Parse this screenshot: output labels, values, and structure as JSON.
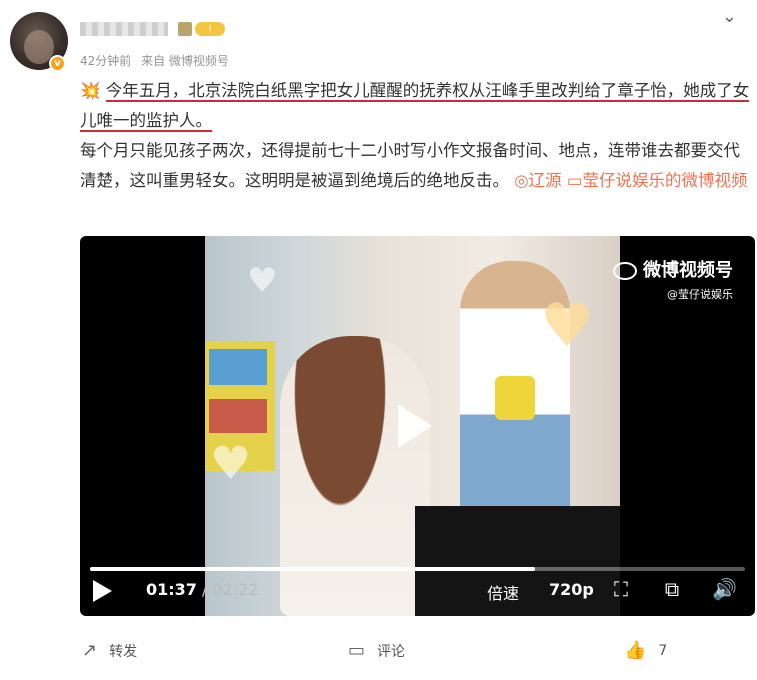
{
  "post": {
    "meta": {
      "time": "42分钟前",
      "source": "来自 微博视频号"
    },
    "rank_icon": "I",
    "text": {
      "emoji": "💥",
      "highlighted": "今年五月，北京法院白纸黑字把女儿醒醒的抚养权从汪峰手里改判给了章子怡，她成了女儿唯一的监护人。",
      "body": "每个月只能见孩子两次，还得提前七十二小时写小作文报备时间、地点，连带谁去都要交代清楚，这叫重男轻女。这明明是被逼到绝境后的绝地反击。",
      "location": "辽源",
      "author_link": "莹仔说娱乐的微博视频"
    }
  },
  "video": {
    "watermark": {
      "brand": "微博视频号",
      "handle": "@莹仔说娱乐"
    },
    "time_current": "01:37",
    "time_sep": " / ",
    "time_total": "02:22",
    "progress": 0.68,
    "speed_label": "倍速",
    "quality_label": "720p"
  },
  "actions": {
    "repost": "转发",
    "comment": "评论",
    "like_count": "7"
  },
  "colors": {
    "link": "#eb7350",
    "underline": "#c92b3a"
  }
}
